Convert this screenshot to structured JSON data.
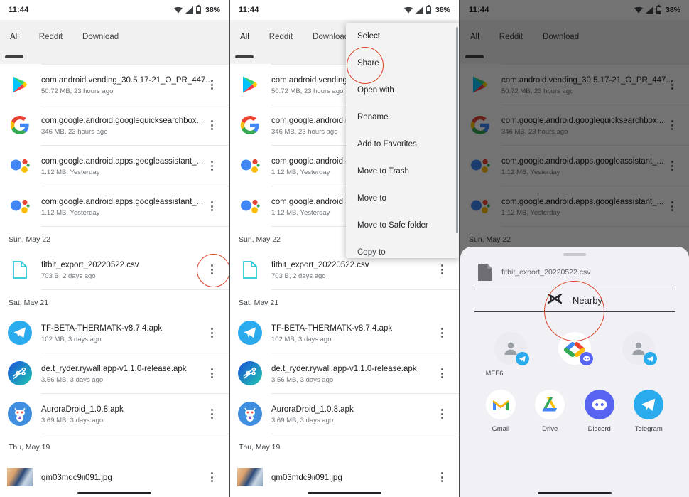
{
  "status_bar": {
    "time": "11:44",
    "battery": "38%",
    "wifi_icon": "wifi-icon",
    "signal_icon": "signal-icon",
    "battery_icon": "battery-icon"
  },
  "tabs": [
    {
      "label": "All",
      "selected": true
    },
    {
      "label": "Reddit",
      "selected": false
    },
    {
      "label": "Download",
      "selected": false
    }
  ],
  "files": [
    {
      "name": "com.android.vending_30.5.17-21_O_PR_447...",
      "sub": "50.72 MB, 23 hours ago",
      "icon": "play-store-icon"
    },
    {
      "name": "com.google.android.googlequicksearchbox...",
      "sub": "346 MB, 23 hours ago",
      "icon": "google-g-icon"
    },
    {
      "name": "com.google.android.apps.googleassistant_...",
      "sub": "1.12 MB, Yesterday",
      "icon": "google-assistant-icon"
    },
    {
      "name": "com.google.android.apps.googleassistant_...",
      "sub": "1.12 MB, Yesterday",
      "icon": "google-assistant-icon"
    }
  ],
  "date_headers": {
    "d1": "Sun, May 22",
    "d2": "Sat, May 21",
    "d3": "Thu, May 19"
  },
  "files2": [
    {
      "name": "fitbit_export_20220522.csv",
      "sub": "703 B, 2 days ago",
      "icon": "csv-file-icon"
    }
  ],
  "files3": [
    {
      "name": "TF-BETA-THERMATK-v8.7.4.apk",
      "sub": "102 MB, 3 days ago",
      "icon": "telegram-icon"
    },
    {
      "name": "de.t_ryder.rywall.app-v1.1.0-release.apk",
      "sub": "3.56 MB, 3 days ago",
      "icon": "rywall-icon"
    },
    {
      "name": "AuroraDroid_1.0.8.apk",
      "sub": "3.69 MB, 3 days ago",
      "icon": "auroradroid-icon"
    }
  ],
  "files4": [
    {
      "name": "qm03mdc9ii091.jpg",
      "sub": "",
      "icon": "photo-thumbnail"
    }
  ],
  "context_menu": {
    "items": [
      {
        "label": "Select"
      },
      {
        "label": "Share",
        "highlighted": true
      },
      {
        "label": "Open with"
      },
      {
        "label": "Rename"
      },
      {
        "label": "Add to Favorites"
      },
      {
        "label": "Move to Trash"
      },
      {
        "label": "Move to"
      },
      {
        "label": "Move to Safe folder"
      },
      {
        "label": "Copy to"
      }
    ]
  },
  "share_sheet": {
    "file_name": "fitbit_export_20220522.csv",
    "nearby_label": "Nearby",
    "nearby_icon": "nearby-share-icon",
    "contacts": [
      {
        "label": "MEE6",
        "avatar": "person-avatar",
        "badge": "telegram-badge"
      },
      {
        "label": "",
        "avatar": "google-chat-avatar",
        "badge": "discord-badge"
      },
      {
        "label": "",
        "avatar": "person-avatar",
        "badge": "telegram-badge"
      }
    ],
    "apps": [
      {
        "label": "Gmail",
        "icon": "gmail-icon"
      },
      {
        "label": "Drive",
        "icon": "google-drive-icon"
      },
      {
        "label": "Discord",
        "icon": "discord-icon"
      },
      {
        "label": "Telegram",
        "icon": "telegram-icon"
      }
    ]
  },
  "annotations": {
    "color": "#d9442b"
  }
}
